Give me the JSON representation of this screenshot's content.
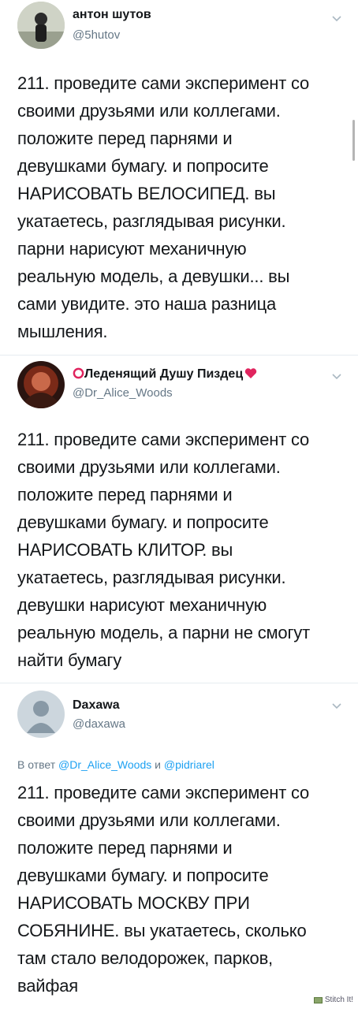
{
  "tweets": [
    {
      "name": "антон шутов",
      "handle": "@5hutov",
      "reply_prefix": "",
      "reply_users": [],
      "lines": [
        "211. проведите сами эксперимент со",
        "своими друзьями или коллегами.",
        "положите перед парнями и",
        "девушками бумагу. и попросите",
        "НАРИСОВАТЬ ВЕЛОСИПЕД. вы",
        "укатаетесь, разглядывая рисунки.",
        "парни нарисуют механичную",
        "реальную модель, а девушки... вы",
        "сами увидите. это наша разница",
        "мышления."
      ]
    },
    {
      "name": "Леденящий Душу Пиздец",
      "name_prefix_icon": "red-circle-icon",
      "name_suffix_icon": "red-heart-icon",
      "handle": "@Dr_Alice_Woods",
      "reply_prefix": "",
      "reply_users": [],
      "lines": [
        "211. проведите сами эксперимент со",
        "своими друзьями или коллегами.",
        "положите перед парнями и",
        "девушками бумагу. и попросите",
        "НАРИСОВАТЬ КЛИТОР. вы",
        "укатаетесь, разглядывая рисунки.",
        "девушки нарисуют механичную",
        "реальную модель, а парни не смогут",
        "найти бумагу"
      ]
    },
    {
      "name": "Daxawa",
      "handle": "@daxawa",
      "reply_prefix": "В ответ",
      "reply_users": [
        "@Dr_Alice_Woods",
        "@pidriarel"
      ],
      "reply_joiner": "и",
      "lines": [
        "211. проведите сами эксперимент со",
        "своими друзьями или коллегами.",
        "положите перед парнями и",
        "девушками бумагу. и попросите",
        "НАРИСОВАТЬ МОСКВУ ПРИ",
        "СОБЯНИНЕ. вы укатаетесь, сколько",
        "там стало велодорожек, парков,",
        "вайфая"
      ]
    }
  ],
  "watermark": "Stitch It!",
  "colors": {
    "text": "#14171a",
    "secondary": "#657786",
    "link": "#1da1f2",
    "divider": "#e6ecf0"
  }
}
